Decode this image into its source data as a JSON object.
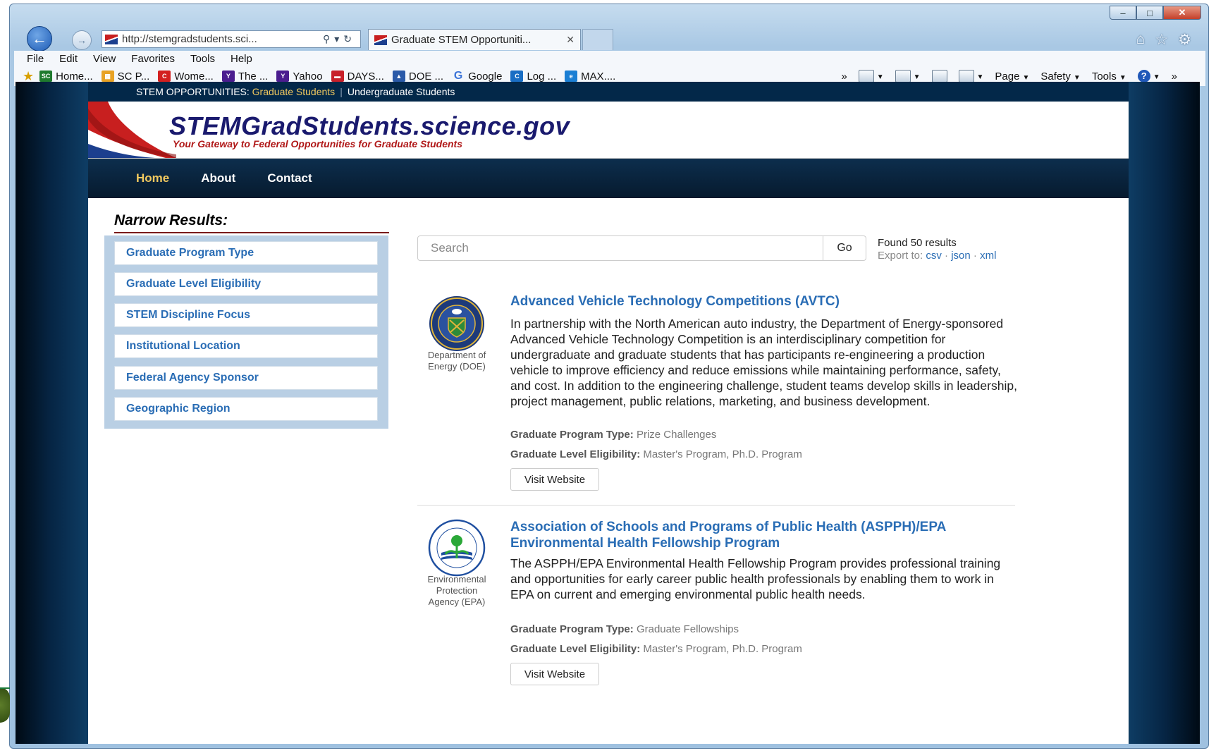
{
  "browser": {
    "window_controls": [
      "–",
      "□",
      "✕"
    ],
    "url": "http://stemgradstudents.sci...",
    "tab_title": "Graduate STEM Opportuniti...",
    "menu": [
      "File",
      "Edit",
      "View",
      "Favorites",
      "Tools",
      "Help"
    ],
    "favorites": [
      "Home...",
      "SC P...",
      "Wome...",
      "The ...",
      "Yahoo",
      "DAYS...",
      "DOE ...",
      "Google",
      "Log ...",
      "MAX...."
    ],
    "commands": {
      "page": "Page",
      "safety": "Safety",
      "tools": "Tools"
    }
  },
  "site": {
    "top_strip": {
      "label": "STEM OPPORTUNITIES:",
      "grad": "Graduate Students",
      "undergrad": "Undergraduate Students"
    },
    "title": "STEMGradStudents.science.gov",
    "tagline": "Your Gateway to Federal Opportunities for Graduate Students",
    "nav": [
      "Home",
      "About",
      "Contact"
    ]
  },
  "sidebar": {
    "title": "Narrow Results:",
    "facets": [
      "Graduate Program Type",
      "Graduate Level Eligibility",
      "STEM Discipline Focus",
      "Institutional Location",
      "Federal Agency Sponsor",
      "Geographic Region"
    ]
  },
  "search": {
    "placeholder": "Search",
    "go": "Go",
    "found": "Found 50 results",
    "export_label": "Export to:",
    "export_csv": "csv",
    "export_json": "json",
    "export_xml": "xml",
    "dot": "·"
  },
  "results": [
    {
      "agency_line1": "Department of",
      "agency_line2": "Energy (DOE)",
      "title": "Advanced Vehicle Technology Competitions (AVTC)",
      "description": "In partnership with the North American auto industry, the Department of Energy-sponsored Advanced Vehicle Technology Competition is an interdisciplinary competition for undergraduate and graduate students that has participants re-engineering a production vehicle to improve efficiency and reduce emissions while maintaining performance, safety, and cost. In addition to the engineering challenge, student teams develop skills in leadership, project management, public relations, marketing, and business development.",
      "program_type_label": "Graduate Program Type:",
      "program_type": "Prize Challenges",
      "level_label": "Graduate Level Eligibility:",
      "level": "Master's Program, Ph.D. Program",
      "visit": "Visit Website"
    },
    {
      "agency_line1": "Environmental",
      "agency_line2": "Protection",
      "agency_line3": "Agency (EPA)",
      "title": "Association of Schools and Programs of Public Health (ASPPH)/EPA Environmental Health Fellowship Program",
      "description": "The ASPPH/EPA Environmental Health Fellowship Program provides professional training and opportunities for early career public health professionals by enabling them to work in EPA on current and emerging environmental public health needs.",
      "program_type_label": "Graduate Program Type:",
      "program_type": "Graduate Fellowships",
      "level_label": "Graduate Level Eligibility:",
      "level": "Master's Program, Ph.D. Program",
      "visit": "Visit Website"
    }
  ],
  "colors": {
    "link": "#2a6db5",
    "nav_active": "#f1c95f",
    "header_dark": "#032849",
    "tagline": "#b01818"
  }
}
